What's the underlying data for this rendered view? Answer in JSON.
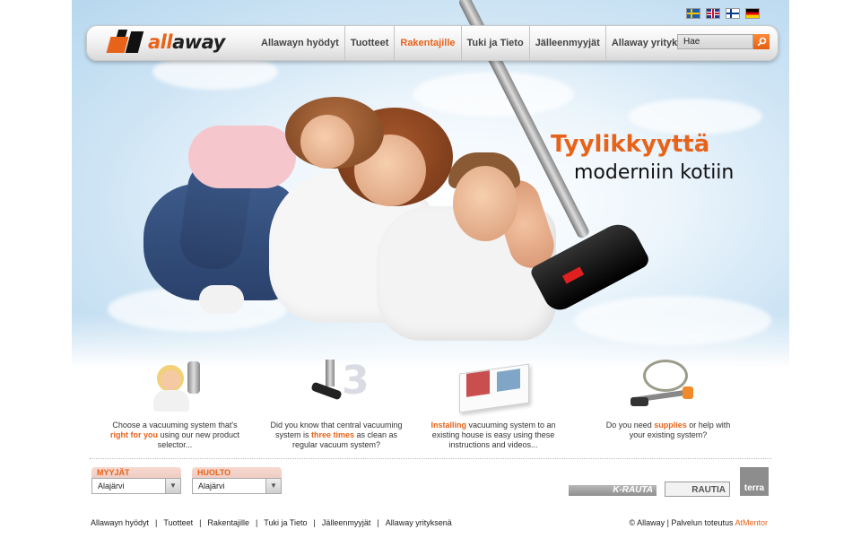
{
  "header": {
    "logo_text_a": "all",
    "logo_text_b": "away",
    "languages": [
      "sv",
      "en",
      "fi",
      "de"
    ],
    "nav": [
      {
        "label": "Allawayn hyödyt",
        "active": false
      },
      {
        "label": "Tuotteet",
        "active": false
      },
      {
        "label": "Rakentajille",
        "active": true
      },
      {
        "label": "Tuki ja Tieto",
        "active": false
      },
      {
        "label": "Jälleenmyyjät",
        "active": false
      },
      {
        "label": "Allaway yrityksenä",
        "active": false
      }
    ],
    "search": {
      "value": "Hae"
    }
  },
  "hero": {
    "title": "Tyylikkyyttä",
    "subtitle": "moderniin kotiin"
  },
  "features": [
    {
      "before": "Choose a vacuuming system that's ",
      "highlight": "right for you",
      "after": " using our new product selector..."
    },
    {
      "before": "Did you know that central vacuuming system is ",
      "highlight": "three times",
      "after": " as clean as regular vacuum system?"
    },
    {
      "before": "",
      "highlight": "Installing",
      "after": " vacuuming system to an existing house is easy using these instructions and videos..."
    },
    {
      "before": "Do you need ",
      "highlight": "supplies",
      "after": " or help with your existing system?"
    }
  ],
  "selectors": [
    {
      "heading": "MYYJÄT",
      "value": "Alajärvi"
    },
    {
      "heading": "HUOLTO",
      "value": "Alajärvi"
    }
  ],
  "partners": {
    "krauta": "K-RAUTA",
    "rautia": "RAUTIA",
    "terra": "terra"
  },
  "footer": {
    "links": [
      "Allawayn hyödyt",
      "Tuotteet",
      "Rakentajille",
      "Tuki ja Tieto",
      "Jälleenmyyjät",
      "Allaway yrityksenä"
    ],
    "copyright": "© Allaway | Palvelun toteutus ",
    "credit": "AtMentor"
  },
  "colors": {
    "accent": "#e8631a",
    "nav_text": "#444444"
  }
}
